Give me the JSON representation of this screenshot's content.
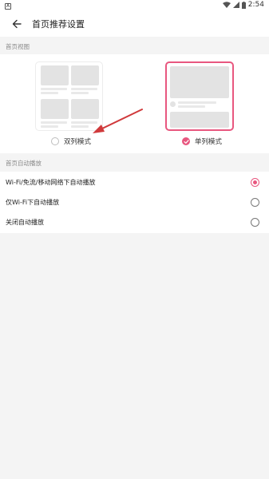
{
  "status_bar": {
    "notification_icon": "A",
    "time": "2:54",
    "icons": [
      "wifi-icon",
      "signal-icon",
      "battery-icon"
    ]
  },
  "app_bar": {
    "title": "首页推荐设置",
    "back_icon": "arrow-left-icon"
  },
  "sections": {
    "view": {
      "header": "首页视图",
      "options": [
        {
          "label": "双列模式",
          "selected": false
        },
        {
          "label": "单列模式",
          "selected": true
        }
      ]
    },
    "autoplay": {
      "header": "首页自动播放",
      "options": [
        {
          "label": "Wi-Fi/免流/移动网络下自动播放",
          "selected": true
        },
        {
          "label": "仅Wi-Fi下自动播放",
          "selected": false
        },
        {
          "label": "关闭自动播放",
          "selected": false
        }
      ]
    }
  },
  "colors": {
    "accent": "#e8577f",
    "annotation_arrow": "#d0393b",
    "background": "#f4f4f4",
    "panel": "#ffffff"
  }
}
